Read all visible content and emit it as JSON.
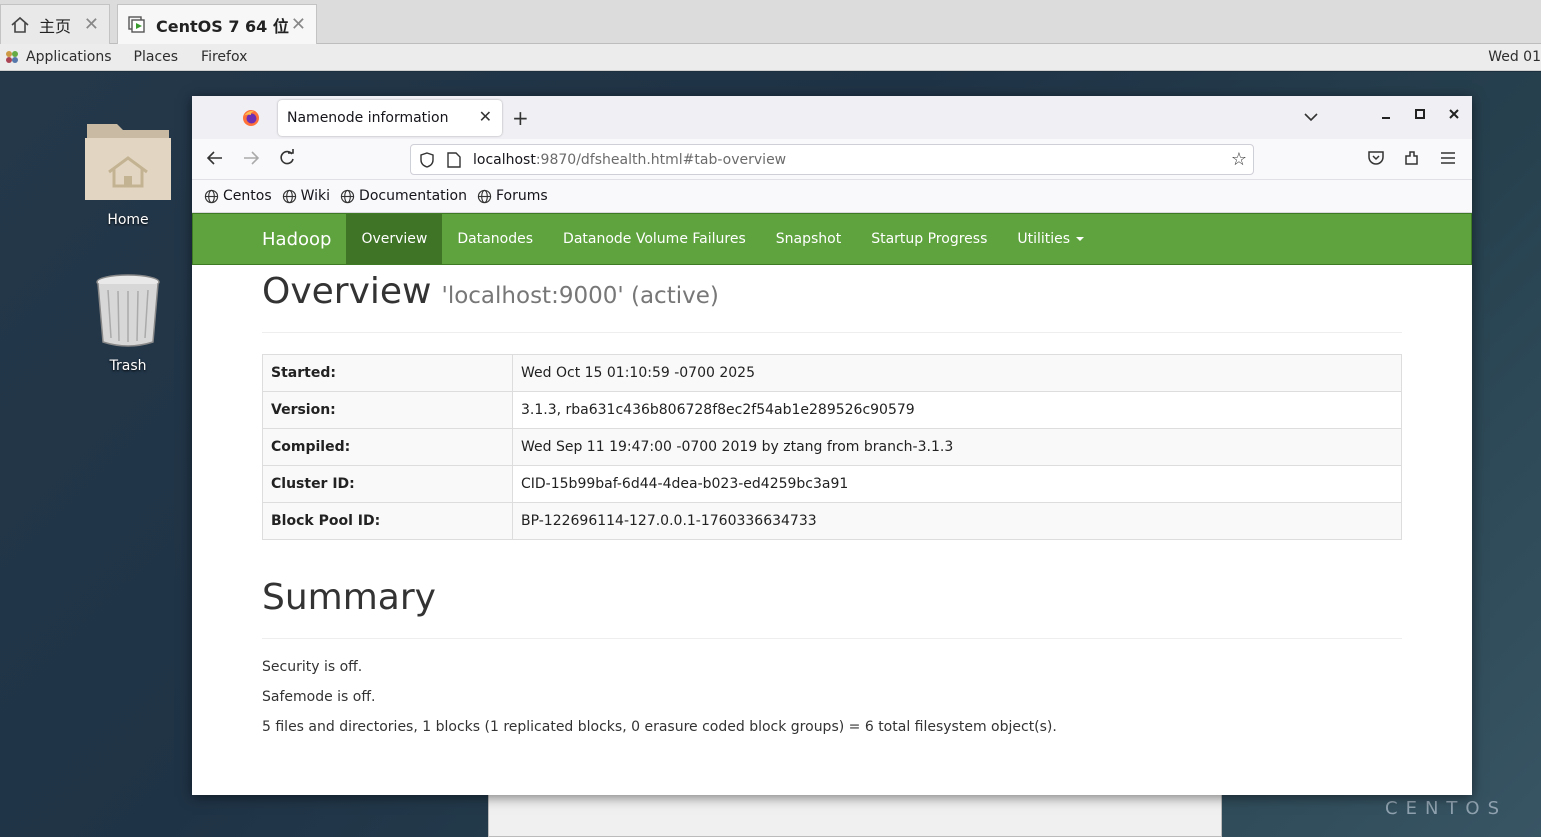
{
  "host_tabs": [
    {
      "label": "主页",
      "icon": "home-icon"
    },
    {
      "label": "CentOS 7 64 位",
      "icon": "vm-icon"
    }
  ],
  "gnome": {
    "applications": "Applications",
    "places": "Places",
    "firefox": "Firefox",
    "clock": "Wed 01"
  },
  "desktop": {
    "icons": [
      {
        "label": "Home",
        "icon": "home-folder-icon"
      },
      {
        "label": "Trash",
        "icon": "trash-icon"
      }
    ],
    "watermark": "CENTOS"
  },
  "browser": {
    "tab_title": "Namenode information",
    "url_host": "localhost",
    "url_rest": ":9870/dfshealth.html#tab-overview",
    "bookmarks": [
      "Centos",
      "Wiki",
      "Documentation",
      "Forums"
    ]
  },
  "hadoop": {
    "brand": "Hadoop",
    "nav": [
      {
        "label": "Overview",
        "active": true
      },
      {
        "label": "Datanodes"
      },
      {
        "label": "Datanode Volume Failures"
      },
      {
        "label": "Snapshot"
      },
      {
        "label": "Startup Progress"
      },
      {
        "label": "Utilities"
      }
    ],
    "overview_title": "Overview",
    "overview_subtitle": "'localhost:9000' (active)",
    "info_rows": [
      {
        "key": "Started:",
        "value": "Wed Oct 15 01:10:59 -0700 2025"
      },
      {
        "key": "Version:",
        "value": "3.1.3, rba631c436b806728f8ec2f54ab1e289526c90579"
      },
      {
        "key": "Compiled:",
        "value": "Wed Sep 11 19:47:00 -0700 2019 by ztang from branch-3.1.3"
      },
      {
        "key": "Cluster ID:",
        "value": "CID-15b99baf-6d44-4dea-b023-ed4259bc3a91"
      },
      {
        "key": "Block Pool ID:",
        "value": "BP-122696114-127.0.0.1-1760336634733"
      }
    ],
    "summary_title": "Summary",
    "summary_lines": [
      "Security is off.",
      "Safemode is off.",
      "5 files and directories, 1 blocks (1 replicated blocks, 0 erasure coded block groups) = 6 total filesystem object(s)."
    ]
  }
}
